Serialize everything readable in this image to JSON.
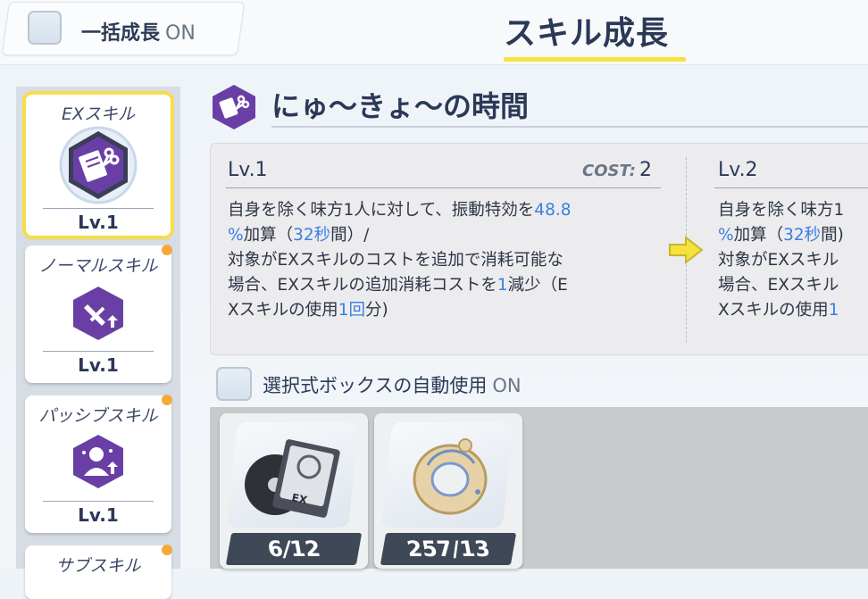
{
  "header": {
    "bulk_growth_label": "一括成長",
    "bulk_growth_state": "ON",
    "title": "スキル成長"
  },
  "skills": [
    {
      "name": "EXスキル",
      "level": "Lv.1",
      "selected": true,
      "icon": "ex-skill-hex-icon"
    },
    {
      "name": "ノーマルスキル",
      "level": "Lv.1",
      "selected": false,
      "icon": "normal-skill-hex-icon"
    },
    {
      "name": "パッシブスキル",
      "level": "Lv.1",
      "selected": false,
      "icon": "passive-skill-hex-icon"
    },
    {
      "name": "サブスキル",
      "level": "",
      "selected": false,
      "icon": "sub-skill-hex-icon"
    }
  ],
  "skill_detail": {
    "name": "にゅ〜きょ〜の時間",
    "current": {
      "level": "Lv.1",
      "cost_label": "COST:",
      "cost_value": "2",
      "lines": [
        [
          "自身を除く味方1人に対して、振動特効を",
          "48.8"
        ],
        [
          "%",
          "加算（",
          "32秒",
          "間）/"
        ],
        [
          "対象がEXスキルのコストを追加で消耗可能な"
        ],
        [
          "場合、EXスキルの追加消耗コストを",
          "1",
          "減少（E"
        ],
        [
          "Xスキルの使用",
          "1回",
          "分)"
        ]
      ]
    },
    "next": {
      "level": "Lv.2",
      "lines": [
        [
          "自身を除く味方1"
        ],
        [
          "%",
          "加算（",
          "32秒",
          "間)"
        ],
        [
          "対象がEXスキル"
        ],
        [
          "場合、EXスキル"
        ],
        [
          "Xスキルの使用",
          "1"
        ]
      ]
    }
  },
  "auto_box": {
    "label": "選択式ボックスの自動使用",
    "state": "ON"
  },
  "materials": [
    {
      "name": "ex-skill-disc-item",
      "owned": "6",
      "required": "12",
      "sufficient": false
    },
    {
      "name": "ring-artifact-item",
      "owned": "257",
      "required": "13",
      "sufficient": true
    }
  ],
  "colors": {
    "accent_yellow": "#f6e23c",
    "skill_purple": "#6a3fa5",
    "highlight_blue": "#3b7ee0",
    "insufficient_red": "#f0453d",
    "sufficient_yellow": "#f4e34c"
  }
}
